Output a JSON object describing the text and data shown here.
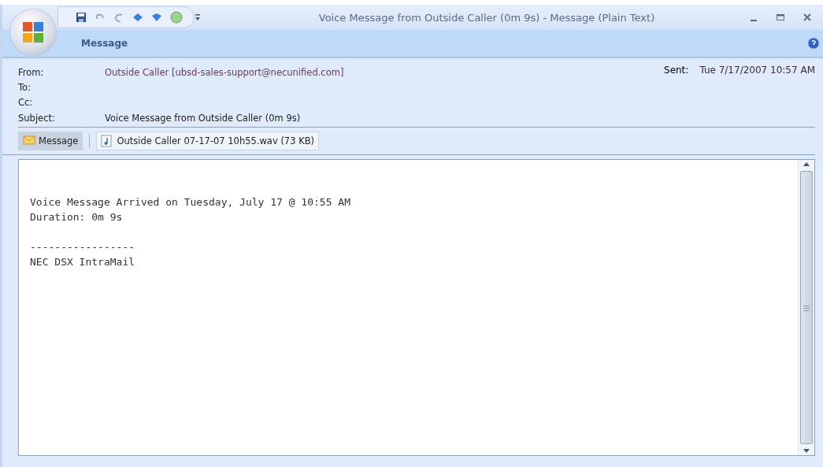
{
  "window": {
    "title": "Voice Message from Outside Caller (0m 9s) - Message (Plain Text)"
  },
  "ribbon_tabs": [
    {
      "label": "Message",
      "selected": true
    }
  ],
  "header": {
    "fields": [
      {
        "label": "From:",
        "value": "Outside Caller [ubsd-sales-support@necunified.com]"
      },
      {
        "label": "To:"
      },
      {
        "label": "Cc:"
      },
      {
        "label": "Subject:",
        "value": "Voice Message from Outside Caller (0m 9s)"
      }
    ],
    "sent": {
      "label": "Sent:",
      "value": "Tue 7/17/2007 10:57 AM"
    }
  },
  "attachments": [
    {
      "label": "Message",
      "kind": "message",
      "selected": true
    },
    {
      "label": "Outside Caller 07-17-07 10h55.wav (73 KB)",
      "kind": "audio",
      "selected": false
    }
  ],
  "body": {
    "paragraphs": [
      [
        "Voice Message Arrived on Tuesday, July 17 @ 10:55 AM",
        "Duration: 0m 9s"
      ],
      [
        "-----------------",
        "NEC DSX IntraMail"
      ]
    ]
  }
}
